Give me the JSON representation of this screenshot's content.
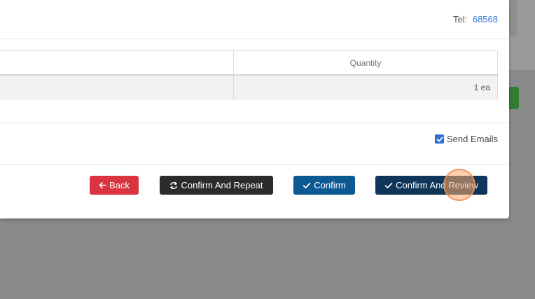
{
  "header": {
    "tel_label": "Tel:",
    "tel_number": "68568"
  },
  "table": {
    "columns": [
      "",
      "Quantity"
    ],
    "rows": [
      {
        "left": "",
        "quantity": "1 ea"
      }
    ]
  },
  "options": {
    "send_emails_label": "Send Emails",
    "send_emails_checked": true
  },
  "buttons": {
    "back": "Back",
    "confirm_repeat": "Confirm And Repeat",
    "confirm": "Confirm",
    "confirm_review": "Confirm And Review"
  },
  "colors": {
    "back": "#d9343f",
    "confirm_repeat": "#2b2b2b",
    "confirm": "#0d5a92",
    "confirm_review": "#0f3558",
    "link": "#3a7bd5"
  },
  "icons": {
    "back": "arrow-left-icon",
    "confirm_repeat": "repeat-icon",
    "confirm": "check-icon",
    "confirm_review": "check-icon"
  }
}
